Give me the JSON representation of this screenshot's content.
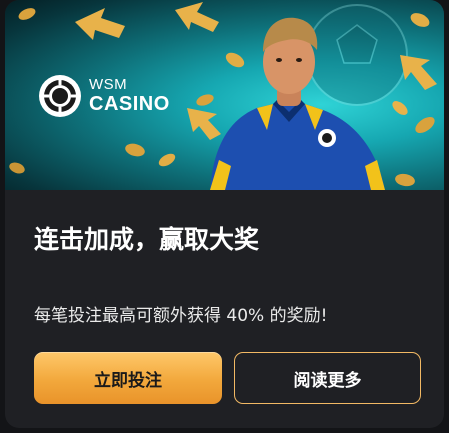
{
  "promo": {
    "brand_top": "WSM",
    "brand_bottom": "CASINO",
    "title": "连击加成，赢取大奖",
    "description": "每笔投注最高可额外获得 40% 的奖励!",
    "primary_button_label": "立即投注",
    "secondary_button_label": "阅读更多"
  },
  "colors": {
    "card_background": "#1f2024",
    "accent_gold": "#f2a83c",
    "button_border": "#f2b964",
    "banner_teal": "#16a7b1",
    "jersey_blue": "#1d4fb0"
  },
  "icons": {
    "logo": "wsm-casino-logo-icon",
    "ball": "soccer-ball-icon",
    "arrows": "gold-arrow-icon",
    "coins": "gold-coin-icon"
  }
}
